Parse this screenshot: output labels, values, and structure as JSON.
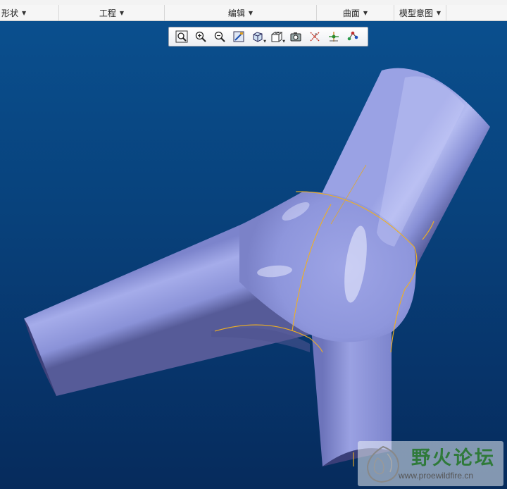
{
  "ribbon": {
    "groups": [
      {
        "label": "形状"
      },
      {
        "label": "工程"
      },
      {
        "label": "编辑"
      },
      {
        "label": "曲面"
      },
      {
        "label": "模型意图"
      }
    ]
  },
  "view_toolbar": {
    "buttons": [
      {
        "icon": "zoom-refit-icon"
      },
      {
        "icon": "zoom-in-icon"
      },
      {
        "icon": "zoom-out-icon"
      },
      {
        "icon": "repaint-icon"
      },
      {
        "icon": "display-style-icon"
      },
      {
        "icon": "saved-orientations-icon"
      },
      {
        "icon": "view-manager-icon"
      },
      {
        "icon": "datum-display-icon"
      },
      {
        "icon": "spin-center-icon"
      },
      {
        "icon": "annotation-display-icon"
      }
    ]
  },
  "watermark": {
    "title": "野火论坛",
    "url": "www.proewildfire.cn"
  },
  "colors": {
    "background_top": "#0a4f8e",
    "background_bottom": "#062b5c",
    "model_surface": "#8d96dc",
    "model_shadow": "#4a4f8a",
    "edge_highlight": "#f0b020"
  }
}
